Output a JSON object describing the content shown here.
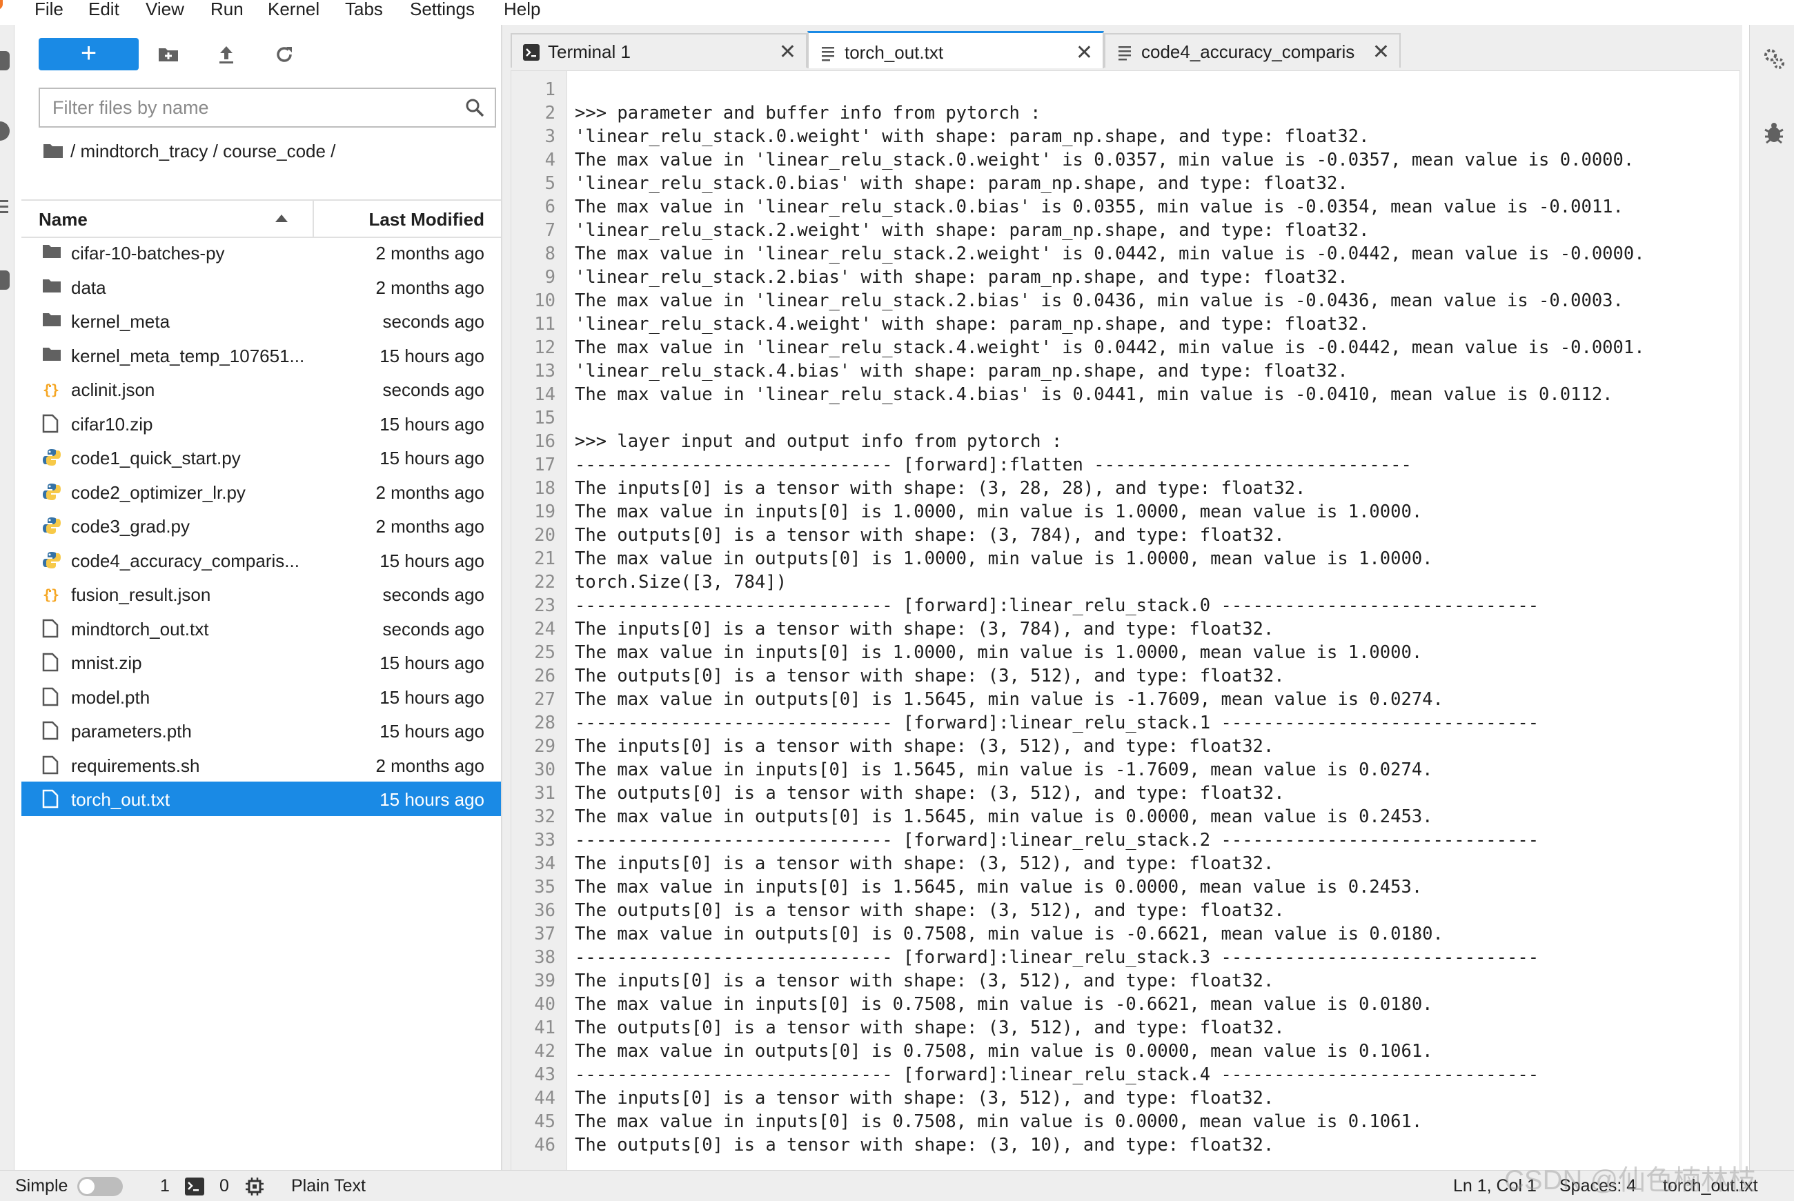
{
  "menubar": {
    "items": [
      "File",
      "Edit",
      "View",
      "Run",
      "Kernel",
      "Tabs",
      "Settings",
      "Help"
    ]
  },
  "filebrowser": {
    "new_label": "+",
    "filter_placeholder": "Filter files by name",
    "breadcrumb": "/ mindtorch_tracy / course_code /",
    "col_name": "Name",
    "col_modified": "Last Modified",
    "files": [
      {
        "name": "cifar-10-batches-py",
        "modified": "2 months ago",
        "icon": "folder-icon"
      },
      {
        "name": "data",
        "modified": "2 months ago",
        "icon": "folder-icon"
      },
      {
        "name": "kernel_meta",
        "modified": "seconds ago",
        "icon": "folder-icon"
      },
      {
        "name": "kernel_meta_temp_107651...",
        "modified": "15 hours ago",
        "icon": "folder-icon"
      },
      {
        "name": "aclinit.json",
        "modified": "seconds ago",
        "icon": "json-icon"
      },
      {
        "name": "cifar10.zip",
        "modified": "15 hours ago",
        "icon": "file-icon"
      },
      {
        "name": "code1_quick_start.py",
        "modified": "15 hours ago",
        "icon": "python-icon"
      },
      {
        "name": "code2_optimizer_lr.py",
        "modified": "2 months ago",
        "icon": "python-icon"
      },
      {
        "name": "code3_grad.py",
        "modified": "2 months ago",
        "icon": "python-icon"
      },
      {
        "name": "code4_accuracy_comparis...",
        "modified": "15 hours ago",
        "icon": "python-icon"
      },
      {
        "name": "fusion_result.json",
        "modified": "seconds ago",
        "icon": "json-icon"
      },
      {
        "name": "mindtorch_out.txt",
        "modified": "seconds ago",
        "icon": "file-icon"
      },
      {
        "name": "mnist.zip",
        "modified": "15 hours ago",
        "icon": "file-icon"
      },
      {
        "name": "model.pth",
        "modified": "15 hours ago",
        "icon": "file-icon"
      },
      {
        "name": "parameters.pth",
        "modified": "15 hours ago",
        "icon": "file-icon"
      },
      {
        "name": "requirements.sh",
        "modified": "2 months ago",
        "icon": "file-icon"
      },
      {
        "name": "torch_out.txt",
        "modified": "15 hours ago",
        "icon": "file-icon",
        "selected": true
      }
    ]
  },
  "tabs": [
    {
      "label": "Terminal 1",
      "icon": "terminal-icon",
      "active": false
    },
    {
      "label": "torch_out.txt",
      "icon": "text-file-icon",
      "active": true
    },
    {
      "label": "code4_accuracy_comparis",
      "icon": "text-file-icon",
      "active": false
    }
  ],
  "editor": {
    "lines": [
      "",
      ">>> parameter and buffer info from pytorch :",
      "'linear_relu_stack.0.weight' with shape: param_np.shape, and type: float32.",
      "The max value in 'linear_relu_stack.0.weight' is 0.0357, min value is -0.0357, mean value is 0.0000.",
      "'linear_relu_stack.0.bias' with shape: param_np.shape, and type: float32.",
      "The max value in 'linear_relu_stack.0.bias' is 0.0355, min value is -0.0354, mean value is -0.0011.",
      "'linear_relu_stack.2.weight' with shape: param_np.shape, and type: float32.",
      "The max value in 'linear_relu_stack.2.weight' is 0.0442, min value is -0.0442, mean value is -0.0000.",
      "'linear_relu_stack.2.bias' with shape: param_np.shape, and type: float32.",
      "The max value in 'linear_relu_stack.2.bias' is 0.0436, min value is -0.0436, mean value is -0.0003.",
      "'linear_relu_stack.4.weight' with shape: param_np.shape, and type: float32.",
      "The max value in 'linear_relu_stack.4.weight' is 0.0442, min value is -0.0442, mean value is -0.0001.",
      "'linear_relu_stack.4.bias' with shape: param_np.shape, and type: float32.",
      "The max value in 'linear_relu_stack.4.bias' is 0.0441, min value is -0.0410, mean value is 0.0112.",
      "",
      ">>> layer input and output info from pytorch :",
      "------------------------------ [forward]:flatten ------------------------------",
      "The inputs[0] is a tensor with shape: (3, 28, 28), and type: float32.",
      "The max value in inputs[0] is 1.0000, min value is 1.0000, mean value is 1.0000.",
      "The outputs[0] is a tensor with shape: (3, 784), and type: float32.",
      "The max value in outputs[0] is 1.0000, min value is 1.0000, mean value is 1.0000.",
      "torch.Size([3, 784])",
      "------------------------------ [forward]:linear_relu_stack.0 ------------------------------",
      "The inputs[0] is a tensor with shape: (3, 784), and type: float32.",
      "The max value in inputs[0] is 1.0000, min value is 1.0000, mean value is 1.0000.",
      "The outputs[0] is a tensor with shape: (3, 512), and type: float32.",
      "The max value in outputs[0] is 1.5645, min value is -1.7609, mean value is 0.0274.",
      "------------------------------ [forward]:linear_relu_stack.1 ------------------------------",
      "The inputs[0] is a tensor with shape: (3, 512), and type: float32.",
      "The max value in inputs[0] is 1.5645, min value is -1.7609, mean value is 0.0274.",
      "The outputs[0] is a tensor with shape: (3, 512), and type: float32.",
      "The max value in outputs[0] is 1.5645, min value is 0.0000, mean value is 0.2453.",
      "------------------------------ [forward]:linear_relu_stack.2 ------------------------------",
      "The inputs[0] is a tensor with shape: (3, 512), and type: float32.",
      "The max value in inputs[0] is 1.5645, min value is 0.0000, mean value is 0.2453.",
      "The outputs[0] is a tensor with shape: (3, 512), and type: float32.",
      "The max value in outputs[0] is 0.7508, min value is -0.6621, mean value is 0.0180.",
      "------------------------------ [forward]:linear_relu_stack.3 ------------------------------",
      "The inputs[0] is a tensor with shape: (3, 512), and type: float32.",
      "The max value in inputs[0] is 0.7508, min value is -0.6621, mean value is 0.0180.",
      "The outputs[0] is a tensor with shape: (3, 512), and type: float32.",
      "The max value in outputs[0] is 0.7508, min value is 0.0000, mean value is 0.1061.",
      "------------------------------ [forward]:linear_relu_stack.4 ------------------------------",
      "The inputs[0] is a tensor with shape: (3, 512), and type: float32.",
      "The max value in inputs[0] is 0.7508, min value is 0.0000, mean value is 0.1061.",
      "The outputs[0] is a tensor with shape: (3, 10), and type: float32."
    ]
  },
  "statusbar": {
    "mode_label": "Simple",
    "terminals_count": "1",
    "kernels_count": "0",
    "file_type": "Plain Text",
    "cursor": "Ln 1, Col 1",
    "spaces": "Spaces: 4",
    "filename": "torch_out.txt"
  },
  "watermark": "CSDN @仙色楠林枝",
  "colors": {
    "accent": "#1a8ae5",
    "python_blue": "#3572a5",
    "python_yellow": "#f7c948",
    "json_orange": "#f5a623",
    "jupyter_orange": "#f37726"
  }
}
